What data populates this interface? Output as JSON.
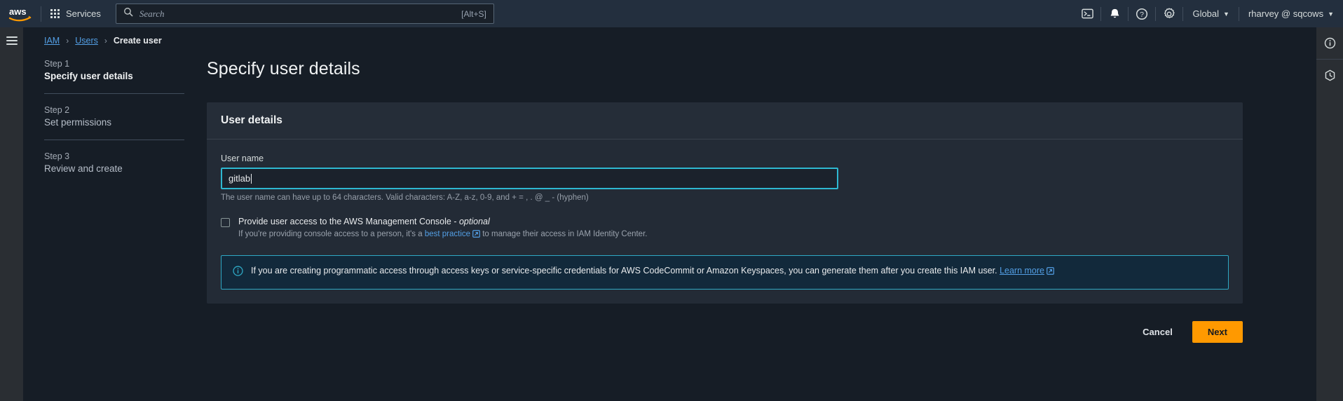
{
  "topnav": {
    "logo_alt": "aws",
    "services_label": "Services",
    "search": {
      "placeholder": "Search",
      "shortcut": "[Alt+S]"
    },
    "cloudshell_icon": "terminal-icon",
    "notifications_icon": "bell-icon",
    "help_icon": "question-circle-icon",
    "settings_icon": "gear-icon",
    "region_label": "Global",
    "account_label": "rharvey @ sqcows",
    "caret": "▼"
  },
  "breadcrumb": {
    "items": [
      {
        "label": "IAM",
        "link": true
      },
      {
        "label": "Users",
        "link": true
      },
      {
        "label": "Create user",
        "link": false
      }
    ],
    "separator": "›"
  },
  "steps": [
    {
      "num": "Step 1",
      "name": "Specify user details",
      "active": true
    },
    {
      "num": "Step 2",
      "name": "Set permissions",
      "active": false
    },
    {
      "num": "Step 3",
      "name": "Review and create",
      "active": false
    }
  ],
  "main": {
    "page_title": "Specify user details",
    "card": {
      "title": "User details",
      "username_label": "User name",
      "username_value": "gitlab",
      "username_hint": "The user name can have up to 64 characters. Valid characters: A-Z, a-z, 0-9, and + = , . @ _ - (hyphen)",
      "console_access": {
        "label_main": "Provide user access to the AWS Management Console - ",
        "label_optional": "optional",
        "checked": false,
        "sub_before": "If you're providing console access to a person, it's a ",
        "sub_link": "best practice",
        "sub_after": " to manage their access in IAM Identity Center."
      },
      "alert": {
        "icon": "info-circle-icon",
        "text_before": "If you are creating programmatic access through access keys or service-specific credentials for AWS CodeCommit or Amazon Keyspaces, you can generate them after you create this IAM user. ",
        "link": "Learn more"
      }
    },
    "actions": {
      "cancel": "Cancel",
      "next": "Next"
    }
  },
  "rightrail": {
    "info_icon": "info-circle-icon",
    "history_icon": "clock-history-icon"
  },
  "colors": {
    "accent_orange": "#ff9900",
    "link_blue": "#539fe5",
    "focus_cyan": "#2eb8d1",
    "nav_bg": "#232f3e",
    "page_bg": "#161d26",
    "card_bg": "#232b36"
  }
}
